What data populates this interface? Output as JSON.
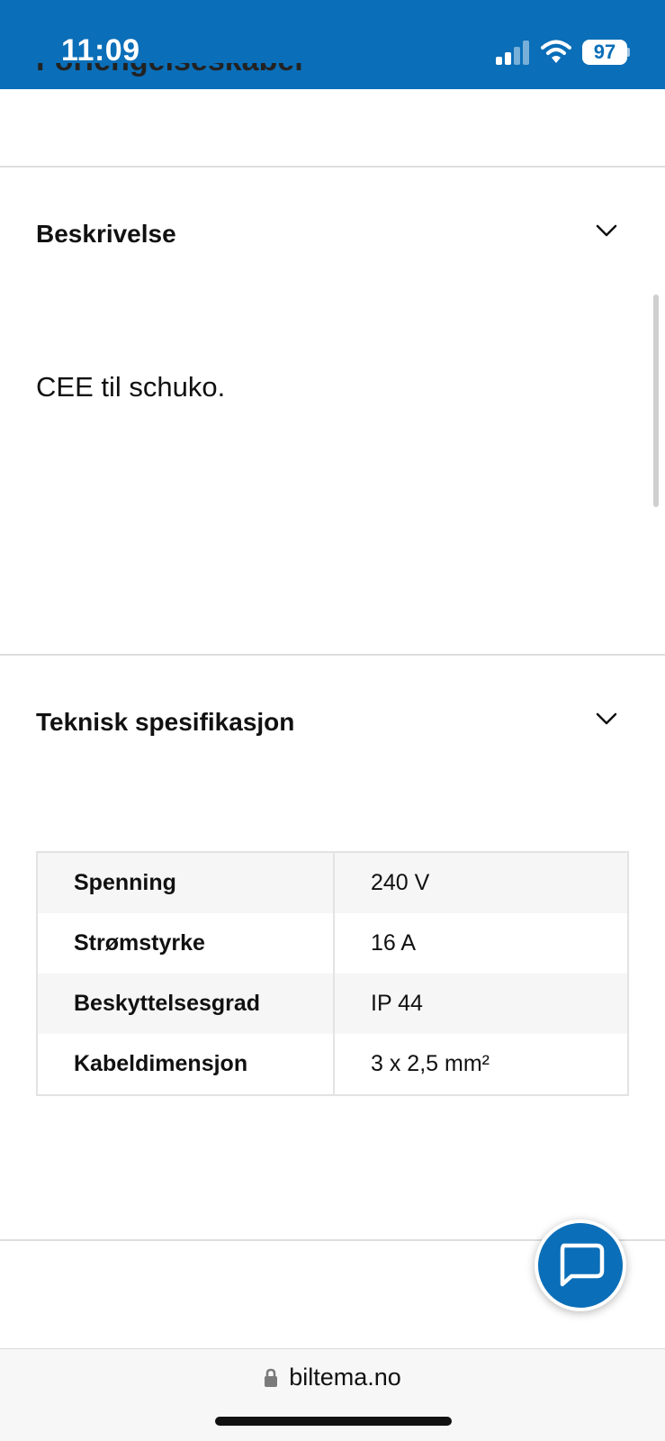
{
  "status_bar": {
    "time": "11:09",
    "battery_level": "97",
    "background_color": "#0a6eb8",
    "icons": [
      "signal-icon",
      "wifi-icon",
      "battery-icon"
    ]
  },
  "clipped_heading": "Forlengelseskabel",
  "sections": {
    "description": {
      "title": "Beskrivelse",
      "body": "CEE til schuko."
    },
    "specification": {
      "title": "Teknisk spesifikasjon",
      "rows": [
        {
          "label": "Spenning",
          "value": "240 V"
        },
        {
          "label": "Strømstyrke",
          "value": "16 A"
        },
        {
          "label": "Beskyttelsesgrad",
          "value": "IP 44"
        },
        {
          "label": "Kabeldimensjon",
          "value": "3 x 2,5 mm²"
        }
      ]
    }
  },
  "chat_button": {
    "icon": "chat-bubble-icon",
    "color": "#0a6eb8"
  },
  "browser": {
    "url": "biltema.no",
    "icon": "lock-icon"
  }
}
